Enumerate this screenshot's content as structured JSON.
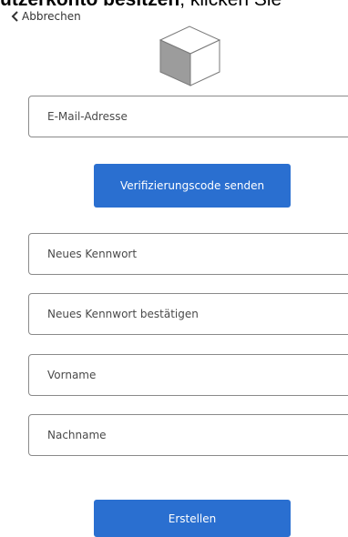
{
  "page": {
    "cut_text_bold": "utzerkonto besitzen",
    "cut_text_rest": ", klicken Sie"
  },
  "nav": {
    "cancel_label": "Abbrechen"
  },
  "form": {
    "email_placeholder": "E-Mail-Adresse",
    "send_code_label": "Verifizierungscode senden",
    "new_password_placeholder": "Neues Kennwort",
    "confirm_password_placeholder": "Neues Kennwort bestätigen",
    "first_name_placeholder": "Vorname",
    "last_name_placeholder": "Nachname",
    "create_label": "Erstellen"
  },
  "icons": {
    "cancel": "chevron-left-icon",
    "logo": "cube-logo"
  },
  "colors": {
    "primary_button": "#2a6fd0",
    "field_border": "#8a8a8a"
  }
}
